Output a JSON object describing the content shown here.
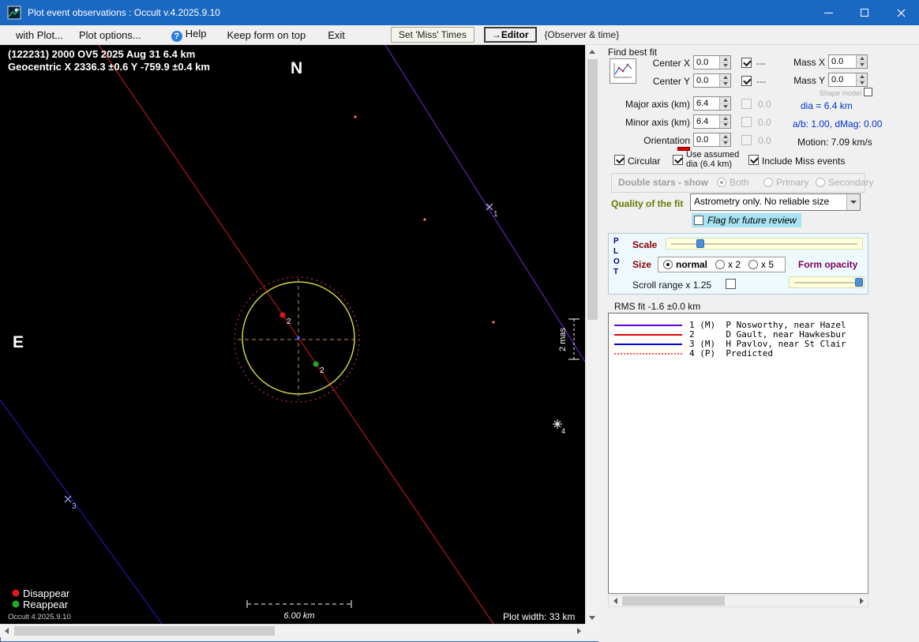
{
  "titlebar": {
    "title": "Plot event observations : Occult v.4.2025.9.10"
  },
  "menubar": {
    "with_plot": "with Plot...",
    "plot_options": "Plot options...",
    "help": "Help",
    "keep_on_top": "Keep form on top",
    "exit": "Exit",
    "set_miss_times": "Set 'Miss' Times",
    "editor": "→Editor",
    "observer_time": "{Observer & time}"
  },
  "plot": {
    "header_line1": "(122231) 2000 OV5  2025 Aug 31   6.4 km",
    "header_line2": "Geocentric  X  2336.3 ±0.6  Y -759.9 ±0.4 km",
    "north_label": "N",
    "east_label": "E",
    "mas_scale_label": "2 mas",
    "scale_bar_label": "6.00 km",
    "plot_width_label": "Plot width: 33 km",
    "disappear_label": "Disappear",
    "reappear_label": "Reappear",
    "version_label": "Occult 4.2025.9.10",
    "marker_chord1": "1",
    "marker_chord3": "3",
    "marker_star4": "4",
    "marker_disappear": "2",
    "marker_reappear": "2"
  },
  "fit_panel": {
    "find_best_fit": "Find best fit",
    "center_x_label": "Center X",
    "center_x": "0.0",
    "center_y_label": "Center Y",
    "center_y": "0.0",
    "dashes_x": "---",
    "dashes_y": "---",
    "mass_x_label": "Mass X",
    "mass_x": "0.0",
    "mass_y_label": "Mass Y",
    "mass_y": "0.0",
    "shape_model": "Shape model",
    "major_axis_label": "Major axis (km)",
    "major_axis": "6.4",
    "major_axis_alt": "0.0",
    "minor_axis_label": "Minor axis (km)",
    "minor_axis": "6.4",
    "minor_axis_alt": "0.0",
    "orientation_label": "Orientation",
    "orientation": "0.0",
    "orientation_alt": "0.0",
    "dia": "dia = 6.4 km",
    "ab_dmag": "a/b: 1.00, dMag: 0.00",
    "motion": "Motion: 7.09 km/s",
    "circular": "Circular",
    "use_assumed_1": "Use assumed",
    "use_assumed_2": "dia (6.4 km)",
    "include_miss": "Include Miss events"
  },
  "double_stars": {
    "label": "Double stars - show",
    "both": "Both",
    "primary": "Primary",
    "secondary": "Secondary"
  },
  "quality": {
    "label": "Quality of the fit",
    "value": "Astrometry only. No reliable size"
  },
  "flag_review": "Flag for future review",
  "plot_controls": {
    "p": "P",
    "l": "L",
    "o": "O",
    "t": "T",
    "scale": "Scale",
    "size": "Size",
    "size_normal": "normal",
    "size_x2": "x 2",
    "size_x5": "x 5",
    "form_opacity": "Form opacity",
    "scroll_range": "Scroll range x 1.25"
  },
  "rms": "RMS fit -1.6 ±0.0 km",
  "observations": [
    {
      "label": "1 (M)  P Nosworthy, near Hazel",
      "color": "#6600cc",
      "style": "solid"
    },
    {
      "label": "2      D Gault, near Hawkesbur",
      "color": "#dd0000",
      "style": "solid"
    },
    {
      "label": "3 (M)  H Pavlov, near St Clair",
      "color": "#0000dd",
      "style": "solid"
    },
    {
      "label": "4 (P)  Predicted",
      "color": "#ff5555",
      "style": "dotted"
    }
  ]
}
